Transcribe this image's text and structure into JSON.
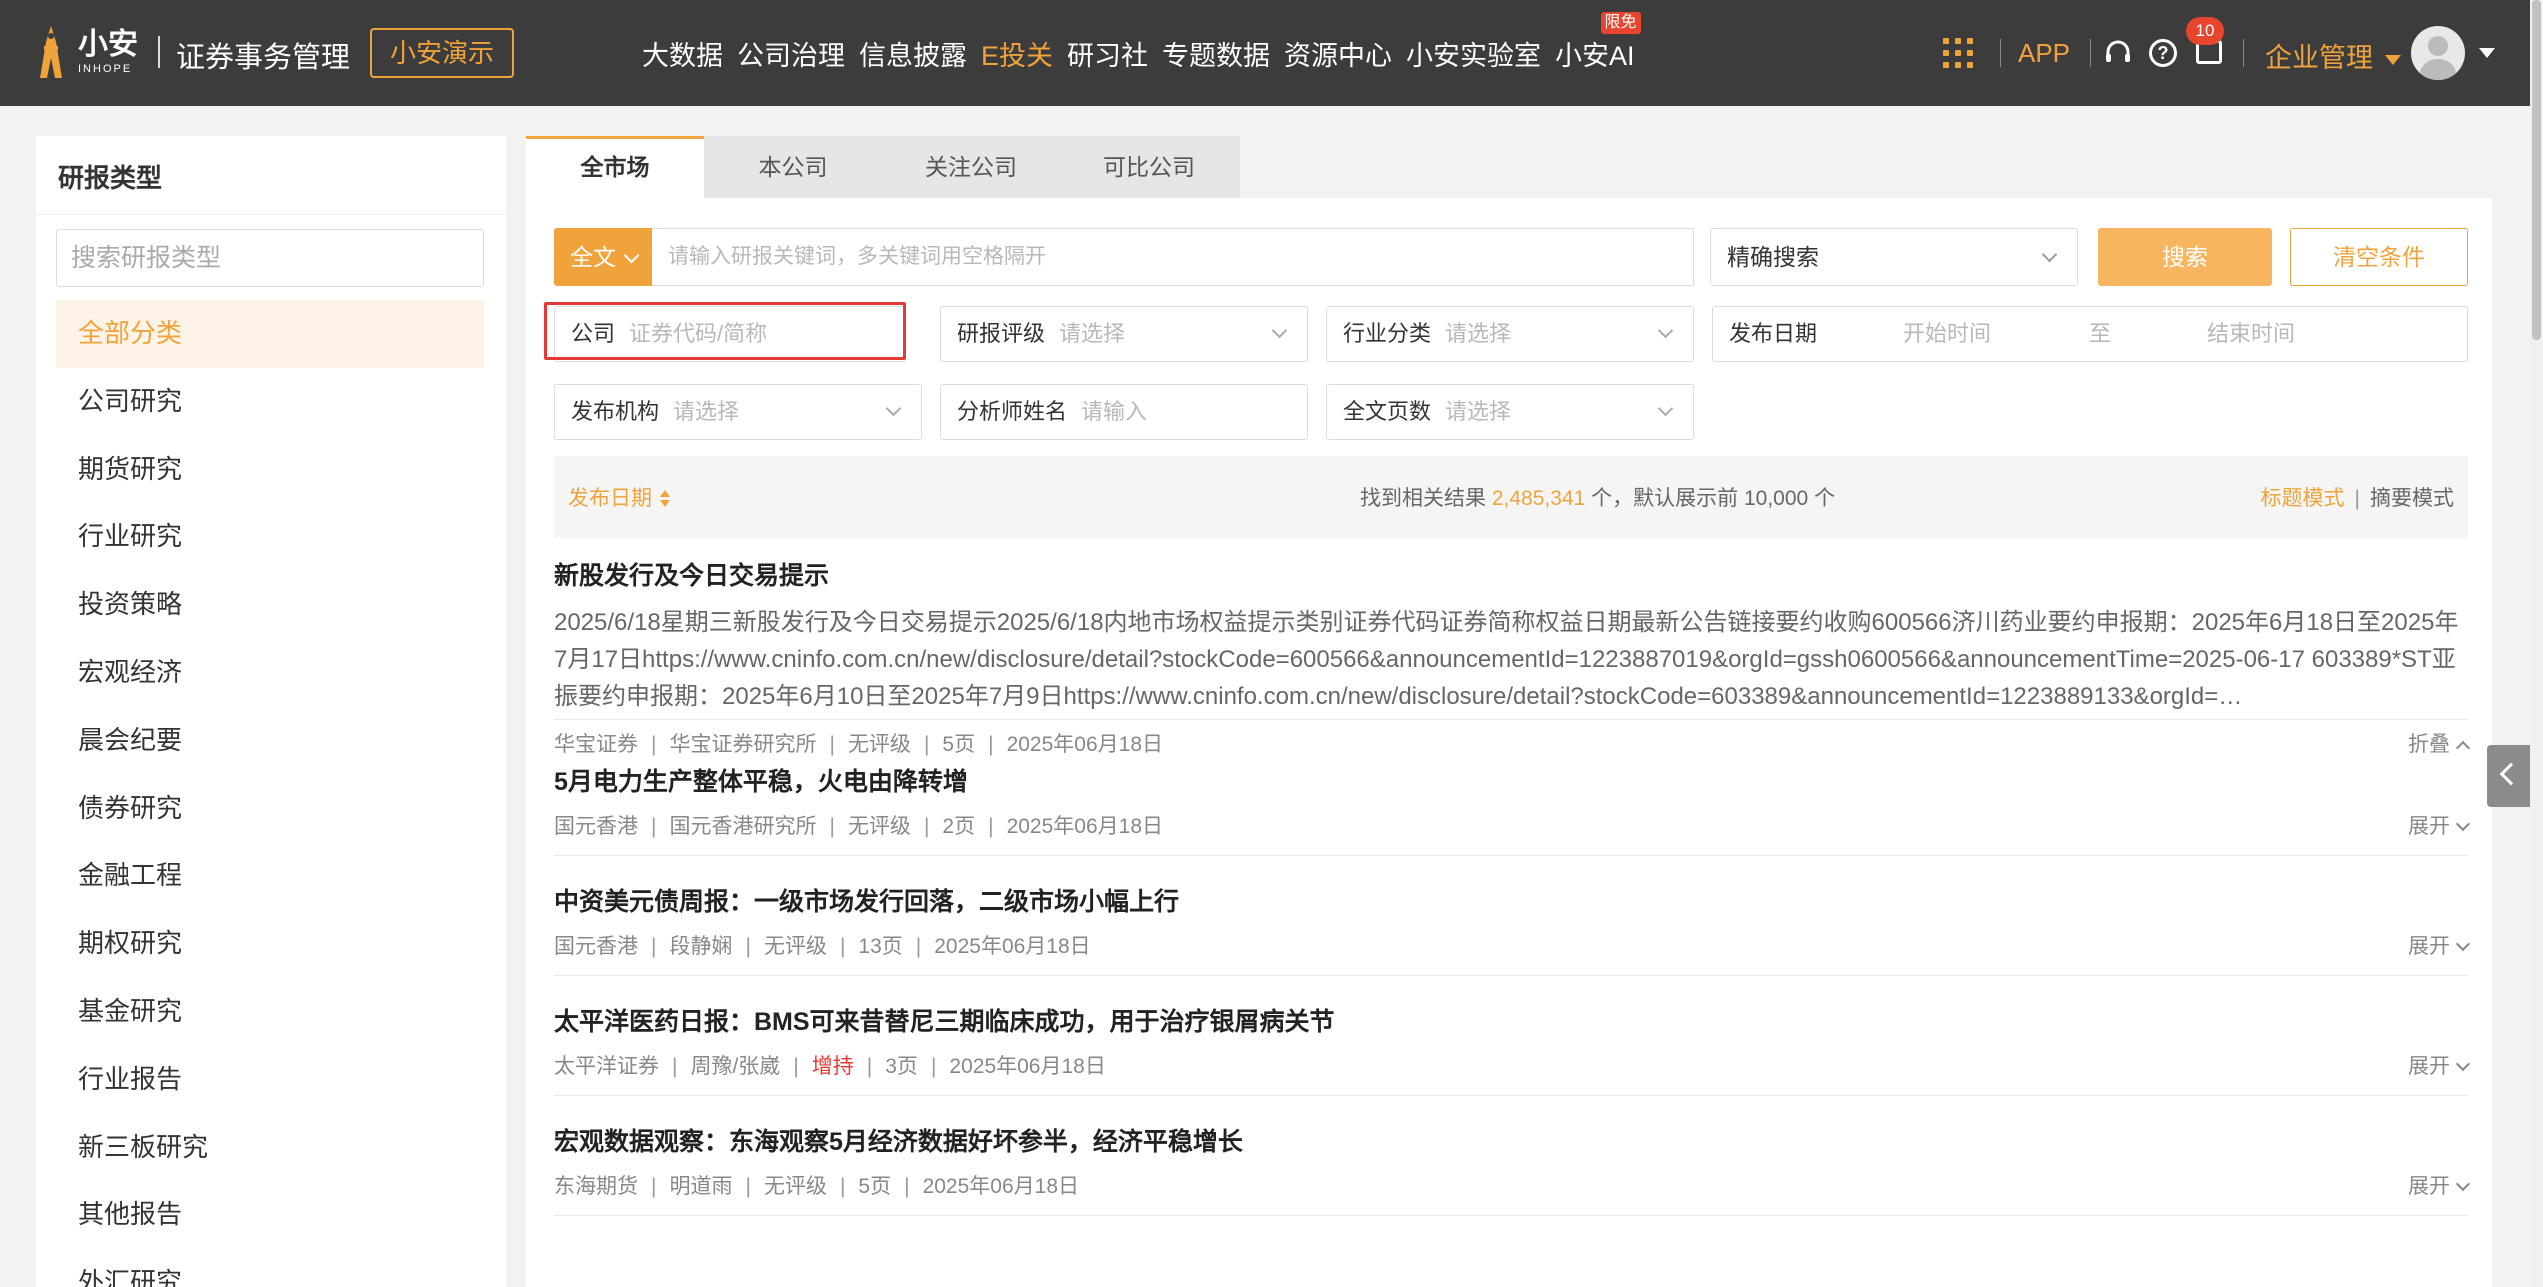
{
  "header": {
    "logo_cn": "小安",
    "logo_en": "INHOPE",
    "product_title": "证券事务管理",
    "demo_label": "小安演示",
    "nav": [
      {
        "label": "大数据",
        "active": false
      },
      {
        "label": "公司治理",
        "active": false
      },
      {
        "label": "信息披露",
        "active": false
      },
      {
        "label": "E投关",
        "active": true
      },
      {
        "label": "研习社",
        "active": false
      },
      {
        "label": "专题数据",
        "active": false
      },
      {
        "label": "资源中心",
        "active": false
      },
      {
        "label": "小安实验室",
        "active": false
      },
      {
        "label": "小安AI",
        "active": false
      }
    ],
    "limited_badge": "限免",
    "app_label": "APP",
    "help_glyph": "?",
    "message_count": "10",
    "enterprise_label": "企业管理",
    "icons": [
      "apps-grid-icon",
      "headset-icon",
      "help-icon",
      "message-icon",
      "avatar"
    ],
    "accent_color": "#f0a33b"
  },
  "sidebar": {
    "title": "研报类型",
    "search_placeholder": "搜索研报类型",
    "items": [
      {
        "label": "全部分类",
        "active": true
      },
      {
        "label": "公司研究"
      },
      {
        "label": "期货研究"
      },
      {
        "label": "行业研究"
      },
      {
        "label": "投资策略"
      },
      {
        "label": "宏观经济"
      },
      {
        "label": "晨会纪要"
      },
      {
        "label": "债券研究"
      },
      {
        "label": "金融工程"
      },
      {
        "label": "期权研究"
      },
      {
        "label": "基金研究"
      },
      {
        "label": "行业报告"
      },
      {
        "label": "新三板研究"
      },
      {
        "label": "其他报告"
      },
      {
        "label": "外汇研究"
      }
    ]
  },
  "tabs": [
    {
      "label": "全市场",
      "active": true
    },
    {
      "label": "本公司"
    },
    {
      "label": "关注公司"
    },
    {
      "label": "可比公司"
    }
  ],
  "search": {
    "scope_label": "全文",
    "keyword_placeholder": "请输入研报关键词，多关键词用空格隔开",
    "mode_label": "精确搜索",
    "search_button": "搜索",
    "clear_button": "清空条件"
  },
  "filters": {
    "company": {
      "label": "公司",
      "placeholder": "证券代码/简称"
    },
    "rating": {
      "label": "研报评级",
      "placeholder": "请选择"
    },
    "industry": {
      "label": "行业分类",
      "placeholder": "请选择"
    },
    "date": {
      "label": "发布日期",
      "start_placeholder": "开始时间",
      "to": "至",
      "end_placeholder": "结束时间"
    },
    "institution": {
      "label": "发布机构",
      "placeholder": "请选择"
    },
    "analyst": {
      "label": "分析师姓名",
      "placeholder": "请输入"
    },
    "pages": {
      "label": "全文页数",
      "placeholder": "请选择"
    }
  },
  "results": {
    "sort_label": "发布日期",
    "count_prefix": "找到相关结果",
    "count": "2,485,341",
    "count_suffix": "个，默认展示前 10,000 个",
    "mode_title": "标题模式",
    "mode_abstract": "摘要模式"
  },
  "reports": [
    {
      "title": "新股发行及今日交易提示",
      "abstract": "2025/6/18星期三新股发行及今日交易提示2025/6/18内地市场权益提示类别证券代码证券简称权益日期最新公告链接要约收购600566济川药业要约申报期：2025年6月18日至2025年7月17日https://www.cninfo.com.cn/new/disclosure/detail?stockCode=600566&announcementId=1223887019&orgId=gssh0600566&announcementTime=2025-06-17 603389*ST亚振要约申报期：2025年6月10日至2025年7月9日https://www.cninfo.com.cn/new/disclosure/detail?stockCode=603389&announcementId=1223889133&orgId=…",
      "broker": "华宝证券",
      "author": "华宝证券研究所",
      "rating": "无评级",
      "pages": "5页",
      "date": "2025年06月18日",
      "toggle": "折叠",
      "expanded": true
    },
    {
      "title": "5月电力生产整体平稳，火电由降转增",
      "broker": "国元香港",
      "author": "国元香港研究所",
      "rating": "无评级",
      "pages": "2页",
      "date": "2025年06月18日",
      "toggle": "展开"
    },
    {
      "title": "中资美元债周报：一级市场发行回落，二级市场小幅上行",
      "broker": "国元香港",
      "author": "段静娴",
      "rating": "无评级",
      "pages": "13页",
      "date": "2025年06月18日",
      "toggle": "展开"
    },
    {
      "title": "太平洋医药日报：BMS可来昔替尼三期临床成功，用于治疗银屑病关节",
      "broker": "太平洋证券",
      "author": "周豫/张崴",
      "rating": "增持",
      "rating_color": "#e53935",
      "pages": "3页",
      "date": "2025年06月18日",
      "toggle": "展开"
    },
    {
      "title": "宏观数据观察：东海观察5月经济数据好坏参半，经济平稳增长",
      "broker": "东海期货",
      "author": "明道雨",
      "rating": "无评级",
      "pages": "5页",
      "date": "2025年06月18日",
      "toggle": "展开"
    }
  ]
}
